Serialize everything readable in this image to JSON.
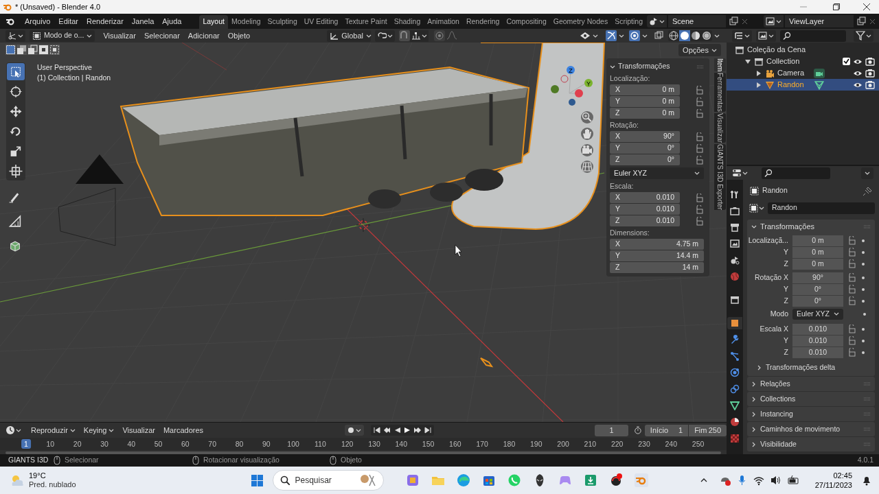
{
  "window": {
    "title": "* (Unsaved) - Blender 4.0"
  },
  "menu": [
    "Arquivo",
    "Editar",
    "Renderizar",
    "Janela",
    "Ajuda"
  ],
  "workspaces": [
    {
      "label": "Layout",
      "selected": true
    },
    {
      "label": "Modeling",
      "selected": false
    },
    {
      "label": "Sculpting",
      "selected": false
    },
    {
      "label": "UV Editing",
      "selected": false
    },
    {
      "label": "Texture Paint",
      "selected": false
    },
    {
      "label": "Shading",
      "selected": false
    },
    {
      "label": "Animation",
      "selected": false
    },
    {
      "label": "Rendering",
      "selected": false
    },
    {
      "label": "Compositing",
      "selected": false
    },
    {
      "label": "Geometry Nodes",
      "selected": false
    },
    {
      "label": "Scripting",
      "selected": false
    }
  ],
  "scene": "Scene",
  "view_layer": "ViewLayer",
  "viewport": {
    "mode": "Modo de o...",
    "menus": [
      "Visualizar",
      "Selecionar",
      "Adicionar",
      "Objeto"
    ],
    "orientation": "Global",
    "options": "Opções",
    "info": [
      "User Perspective",
      "(1) Collection | Randon"
    ],
    "gizmo": [
      "Z",
      "Y"
    ],
    "tools": [
      {
        "kind": "select",
        "selected": true
      },
      {
        "kind": "cursor",
        "selected": false
      },
      {
        "kind": "move",
        "selected": false
      },
      {
        "kind": "rotate",
        "selected": false
      },
      {
        "kind": "scale",
        "selected": false
      },
      {
        "kind": "transform",
        "selected": false
      },
      {
        "kind": "annotate",
        "selected": false
      },
      {
        "kind": "measure",
        "selected": false
      },
      {
        "kind": "add",
        "selected": false
      }
    ],
    "sidebar_tabs": [
      {
        "label": "Item",
        "selected": true
      },
      {
        "label": "Ferramentas",
        "selected": false
      },
      {
        "label": "Visualizar",
        "selected": false
      },
      {
        "label": "GIANTS I3D Exporter",
        "selected": false
      }
    ],
    "panel": {
      "title": "Transformações",
      "items": [
        {
          "kind": "group",
          "label": "Localização:",
          "rows": [
            {
              "axis": "X",
              "value": "0 m",
              "locked": false
            },
            {
              "axis": "Y",
              "value": "0 m",
              "locked": false
            },
            {
              "axis": "Z",
              "value": "0 m",
              "locked": false
            }
          ]
        },
        {
          "kind": "group",
          "label": "Rotação:",
          "rows": [
            {
              "axis": "X",
              "value": "90°",
              "locked": false
            },
            {
              "axis": "Y",
              "value": "0°",
              "locked": false
            },
            {
              "axis": "Z",
              "value": "0°",
              "locked": false
            }
          ]
        },
        {
          "kind": "dropdown",
          "value": "Euler XYZ"
        },
        {
          "kind": "group",
          "label": "Escala:",
          "rows": [
            {
              "axis": "X",
              "value": "0.010",
              "locked": false
            },
            {
              "axis": "Y",
              "value": "0.010",
              "locked": false
            },
            {
              "axis": "Z",
              "value": "0.010",
              "locked": false
            }
          ]
        },
        {
          "kind": "group",
          "label": "Dimensions:",
          "rows": [
            {
              "axis": "X",
              "value": "4.75 m"
            },
            {
              "axis": "Y",
              "value": "14.4 m"
            },
            {
              "axis": "Z",
              "value": "14 m"
            }
          ]
        }
      ]
    }
  },
  "timeline": {
    "menus": [
      "Reproduzir",
      "Keying",
      "Visualizar",
      "Marcadores"
    ],
    "current_frame": "1",
    "start_label": "Início",
    "start": "1",
    "end_label": "Fim",
    "end": "250",
    "ruler": [
      {
        "label": "1",
        "selected": true
      },
      {
        "label": "10",
        "selected": false
      },
      {
        "label": "20",
        "selected": false
      },
      {
        "label": "30",
        "selected": false
      },
      {
        "label": "40",
        "selected": false
      },
      {
        "label": "50",
        "selected": false
      },
      {
        "label": "60",
        "selected": false
      },
      {
        "label": "70",
        "selected": false
      },
      {
        "label": "80",
        "selected": false
      },
      {
        "label": "90",
        "selected": false
      },
      {
        "label": "100",
        "selected": false
      },
      {
        "label": "110",
        "selected": false
      },
      {
        "label": "120",
        "selected": false
      },
      {
        "label": "130",
        "selected": false
      },
      {
        "label": "140",
        "selected": false
      },
      {
        "label": "150",
        "selected": false
      },
      {
        "label": "160",
        "selected": false
      },
      {
        "label": "170",
        "selected": false
      },
      {
        "label": "180",
        "selected": false
      },
      {
        "label": "190",
        "selected": false
      },
      {
        "label": "200",
        "selected": false
      },
      {
        "label": "210",
        "selected": false
      },
      {
        "label": "220",
        "selected": false
      },
      {
        "label": "230",
        "selected": false
      },
      {
        "label": "240",
        "selected": false
      },
      {
        "label": "250",
        "selected": false
      }
    ]
  },
  "outliner": {
    "tree": [
      {
        "label": "Coleção da Cena",
        "kind": "scene",
        "selected": false,
        "children": [
          {
            "label": "Collection",
            "kind": "collection",
            "selected": false,
            "expanded": true,
            "checked": true,
            "children": [
              {
                "label": "Camera",
                "kind": "camera",
                "selected": false,
                "expanded": false
              },
              {
                "label": "Randon",
                "kind": "mesh",
                "selected": true,
                "expanded": false
              }
            ]
          }
        ]
      }
    ]
  },
  "properties": {
    "object": "Randon",
    "name": "Randon",
    "tabs": [
      {
        "kind": "tool",
        "selected": false
      },
      {
        "kind": "render",
        "selected": false
      },
      {
        "kind": "output",
        "selected": false
      },
      {
        "kind": "view_layer",
        "selected": false
      },
      {
        "kind": "scene",
        "selected": false
      },
      {
        "kind": "world",
        "selected": false
      },
      {
        "kind": "collection",
        "selected": false
      },
      {
        "kind": "object",
        "selected": true
      },
      {
        "kind": "modifiers",
        "selected": false
      },
      {
        "kind": "particles",
        "selected": false
      },
      {
        "kind": "physics",
        "selected": false
      },
      {
        "kind": "constraints",
        "selected": false
      },
      {
        "kind": "data",
        "selected": false
      },
      {
        "kind": "material",
        "selected": false
      },
      {
        "kind": "texture",
        "selected": false
      }
    ],
    "panel_title": "Transformações",
    "rows": [
      {
        "kind": "field",
        "label": "Localizaçã...",
        "value": "0 m",
        "locked": false
      },
      {
        "kind": "field",
        "label": "Y",
        "value": "0 m",
        "locked": false
      },
      {
        "kind": "field",
        "label": "Z",
        "value": "0 m",
        "locked": false
      },
      {
        "kind": "field",
        "label": "Rotação X",
        "value": "90°",
        "locked": false
      },
      {
        "kind": "field",
        "label": "Y",
        "value": "0°",
        "locked": false
      },
      {
        "kind": "field",
        "label": "Z",
        "value": "0°",
        "locked": false
      },
      {
        "kind": "dropdown",
        "label": "Modo",
        "value": "Euler XYZ"
      },
      {
        "kind": "field",
        "label": "Escala X",
        "value": "0.010",
        "locked": false
      },
      {
        "kind": "field",
        "label": "Y",
        "value": "0.010",
        "locked": false
      },
      {
        "kind": "field",
        "label": "Z",
        "value": "0.010",
        "locked": false
      }
    ],
    "subpanel": "Transformações delta",
    "panels": [
      "Relações",
      "Collections",
      "Instancing",
      "Caminhos de movimento",
      "Visibilidade"
    ]
  },
  "status_bar": {
    "addon": "GIANTS I3D",
    "hints": [
      "Selecionar",
      "Rotacionar visualização",
      "Objeto"
    ],
    "version": "4.0.1"
  },
  "taskbar": {
    "temperature": "19°C",
    "weather": "Pred. nublado",
    "search": "Pesquisar",
    "time": "02:45",
    "date": "27/11/2023"
  }
}
